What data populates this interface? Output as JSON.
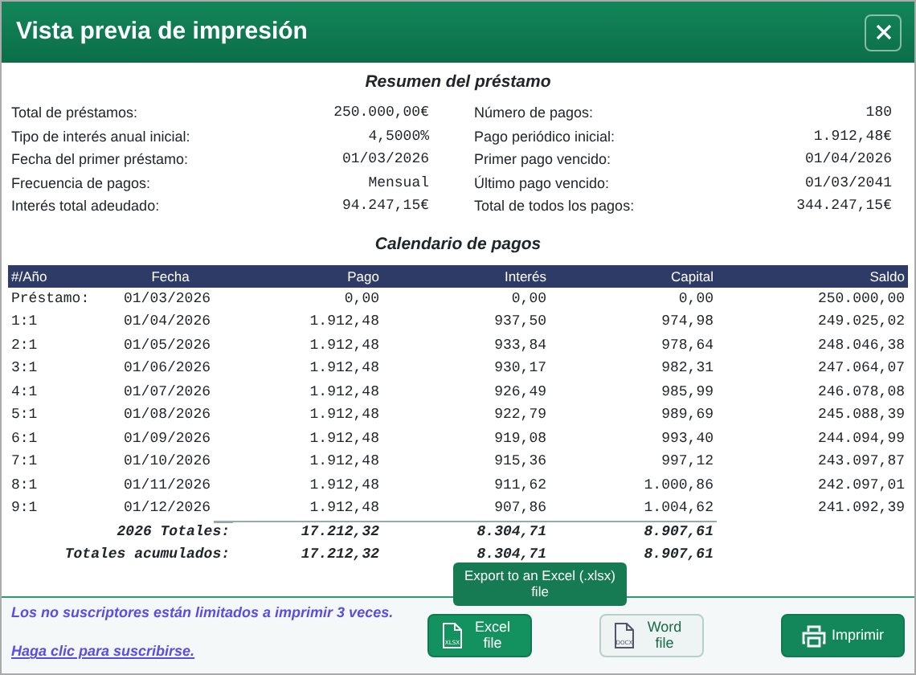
{
  "dialog": {
    "title": "Vista previa de impresión"
  },
  "summary": {
    "title": "Resumen del préstamo",
    "left": [
      {
        "label": "Total de préstamos:",
        "value": "250.000,00€"
      },
      {
        "label": "Tipo de interés anual inicial:",
        "value": "4,5000%"
      },
      {
        "label": "Fecha del primer préstamo:",
        "value": "01/03/2026"
      },
      {
        "label": "Frecuencia de pagos:",
        "value": "Mensual"
      },
      {
        "label": "Interés total adeudado:",
        "value": "94.247,15€"
      }
    ],
    "right": [
      {
        "label": "Número de pagos:",
        "value": "180"
      },
      {
        "label": "Pago periódico inicial:",
        "value": "1.912,48€"
      },
      {
        "label": "Primer pago vencido:",
        "value": "01/04/2026"
      },
      {
        "label": "Último pago vencido:",
        "value": "01/03/2041"
      },
      {
        "label": "Total de todos los pagos:",
        "value": "344.247,15€"
      }
    ]
  },
  "schedule": {
    "title": "Calendario de pagos",
    "columns": [
      "#/Año",
      "Fecha",
      "Pago",
      "Interés",
      "Capital",
      "Saldo"
    ],
    "rows": [
      {
        "kind": "payment",
        "cells": [
          "Préstamo:",
          "01/03/2026",
          "0,00",
          "0,00",
          "0,00",
          "250.000,00"
        ]
      },
      {
        "kind": "payment",
        "cells": [
          "1:1",
          "01/04/2026",
          "1.912,48",
          "937,50",
          "974,98",
          "249.025,02"
        ]
      },
      {
        "kind": "payment",
        "cells": [
          "2:1",
          "01/05/2026",
          "1.912,48",
          "933,84",
          "978,64",
          "248.046,38"
        ]
      },
      {
        "kind": "payment",
        "cells": [
          "3:1",
          "01/06/2026",
          "1.912,48",
          "930,17",
          "982,31",
          "247.064,07"
        ]
      },
      {
        "kind": "payment",
        "cells": [
          "4:1",
          "01/07/2026",
          "1.912,48",
          "926,49",
          "985,99",
          "246.078,08"
        ]
      },
      {
        "kind": "payment",
        "cells": [
          "5:1",
          "01/08/2026",
          "1.912,48",
          "922,79",
          "989,69",
          "245.088,39"
        ]
      },
      {
        "kind": "payment",
        "cells": [
          "6:1",
          "01/09/2026",
          "1.912,48",
          "919,08",
          "993,40",
          "244.094,99"
        ]
      },
      {
        "kind": "payment",
        "cells": [
          "7:1",
          "01/10/2026",
          "1.912,48",
          "915,36",
          "997,12",
          "243.097,87"
        ]
      },
      {
        "kind": "payment",
        "cells": [
          "8:1",
          "01/11/2026",
          "1.912,48",
          "911,62",
          "1.000,86",
          "242.097,01"
        ]
      },
      {
        "kind": "payment",
        "cells": [
          "9:1",
          "01/12/2026",
          "1.912,48",
          "907,86",
          "1.004,62",
          "241.092,39"
        ]
      }
    ],
    "totals": [
      {
        "label": "2026 Totales:",
        "pago": "17.212,32",
        "interes": "8.304,71",
        "capital": "8.907,61"
      },
      {
        "label": "Totales acumulados:",
        "pago": "17.212,32",
        "interes": "8.304,71",
        "capital": "8.907,61"
      }
    ]
  },
  "footer": {
    "notice": "Los no suscriptores están limitados a imprimir 3 veces.",
    "link": "Haga clic para suscribirse.",
    "buttons": [
      {
        "kind": "excel",
        "label": "Excel file",
        "icon_text": "XLSX",
        "tooltip": "Export to an Excel (.xlsx) file"
      },
      {
        "kind": "word",
        "label": "Word file",
        "icon_text": "DOCX"
      },
      {
        "kind": "print",
        "label": "Imprimir"
      }
    ]
  }
}
